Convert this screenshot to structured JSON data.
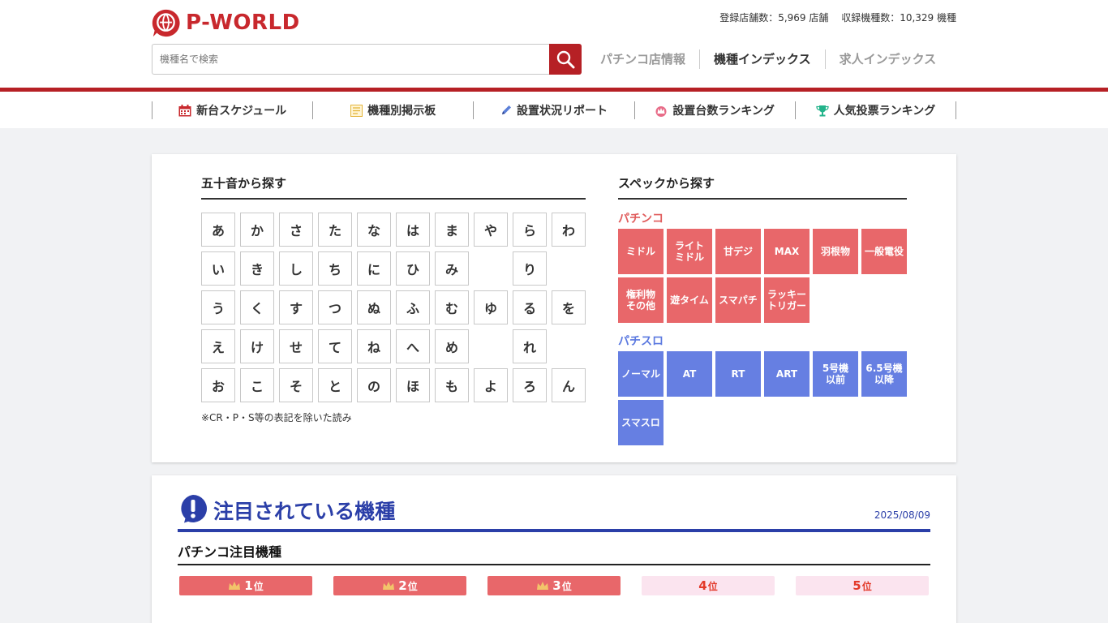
{
  "header": {
    "logo_text": "P-WORLD",
    "stats": {
      "stores": "登録店舗数：5,969 店舗",
      "machines": "収録機種数：10,329 機種"
    },
    "search": {
      "placeholder": "機種名で検索"
    },
    "nav": [
      {
        "label": "パチンコ店情報",
        "active": false
      },
      {
        "label": "機種インデックス",
        "active": true
      },
      {
        "label": "求人インデックス",
        "active": false
      }
    ]
  },
  "subnav": [
    {
      "label": "新台スケジュール",
      "icon": "calendar-icon"
    },
    {
      "label": "機種別掲示板",
      "icon": "notepad-icon"
    },
    {
      "label": "設置状況リポート",
      "icon": "pencil-icon"
    },
    {
      "label": "設置台数ランキング",
      "icon": "crown-icon"
    },
    {
      "label": "人気投票ランキング",
      "icon": "trophy-icon"
    }
  ],
  "kana_section": {
    "title": "五十音から探す",
    "rows": [
      [
        "あ",
        "か",
        "さ",
        "た",
        "な",
        "は",
        "ま",
        "や",
        "ら",
        "わ"
      ],
      [
        "い",
        "き",
        "し",
        "ち",
        "に",
        "ひ",
        "み",
        "",
        "り",
        ""
      ],
      [
        "う",
        "く",
        "す",
        "つ",
        "ぬ",
        "ふ",
        "む",
        "ゆ",
        "る",
        "を"
      ],
      [
        "え",
        "け",
        "せ",
        "て",
        "ね",
        "へ",
        "め",
        "",
        "れ",
        ""
      ],
      [
        "お",
        "こ",
        "そ",
        "と",
        "の",
        "ほ",
        "も",
        "よ",
        "ろ",
        "ん"
      ]
    ],
    "note": "※CR・P・S等の表記を除いた読み"
  },
  "spec_section": {
    "title": "スペックから探す",
    "pachinko_label": "パチンコ",
    "pachinko": [
      "ミドル",
      "ライト\nミドル",
      "甘デジ",
      "MAX",
      "羽根物",
      "一般電役",
      "権利物\nその他",
      "遊タイム",
      "スマパチ",
      "ラッキー\nトリガー"
    ],
    "slot_label": "パチスロ",
    "slot": [
      "ノーマル",
      "AT",
      "RT",
      "ART",
      "5号機\n以前",
      "6.5号機\n以降",
      "スマスロ"
    ]
  },
  "featured": {
    "title": "注目されている機種",
    "date": "2025/08/09",
    "subtitle": "パチンコ注目機種",
    "ranks": [
      {
        "num": "1",
        "suffix": "位"
      },
      {
        "num": "2",
        "suffix": "位"
      },
      {
        "num": "3",
        "suffix": "位"
      },
      {
        "num": "4",
        "suffix": "位"
      },
      {
        "num": "5",
        "suffix": "位"
      }
    ]
  },
  "colors": {
    "brand_red": "#b62025",
    "pachinko": "#e8676a",
    "slot": "#667fe2",
    "featured_blue": "#2b3fa8"
  }
}
